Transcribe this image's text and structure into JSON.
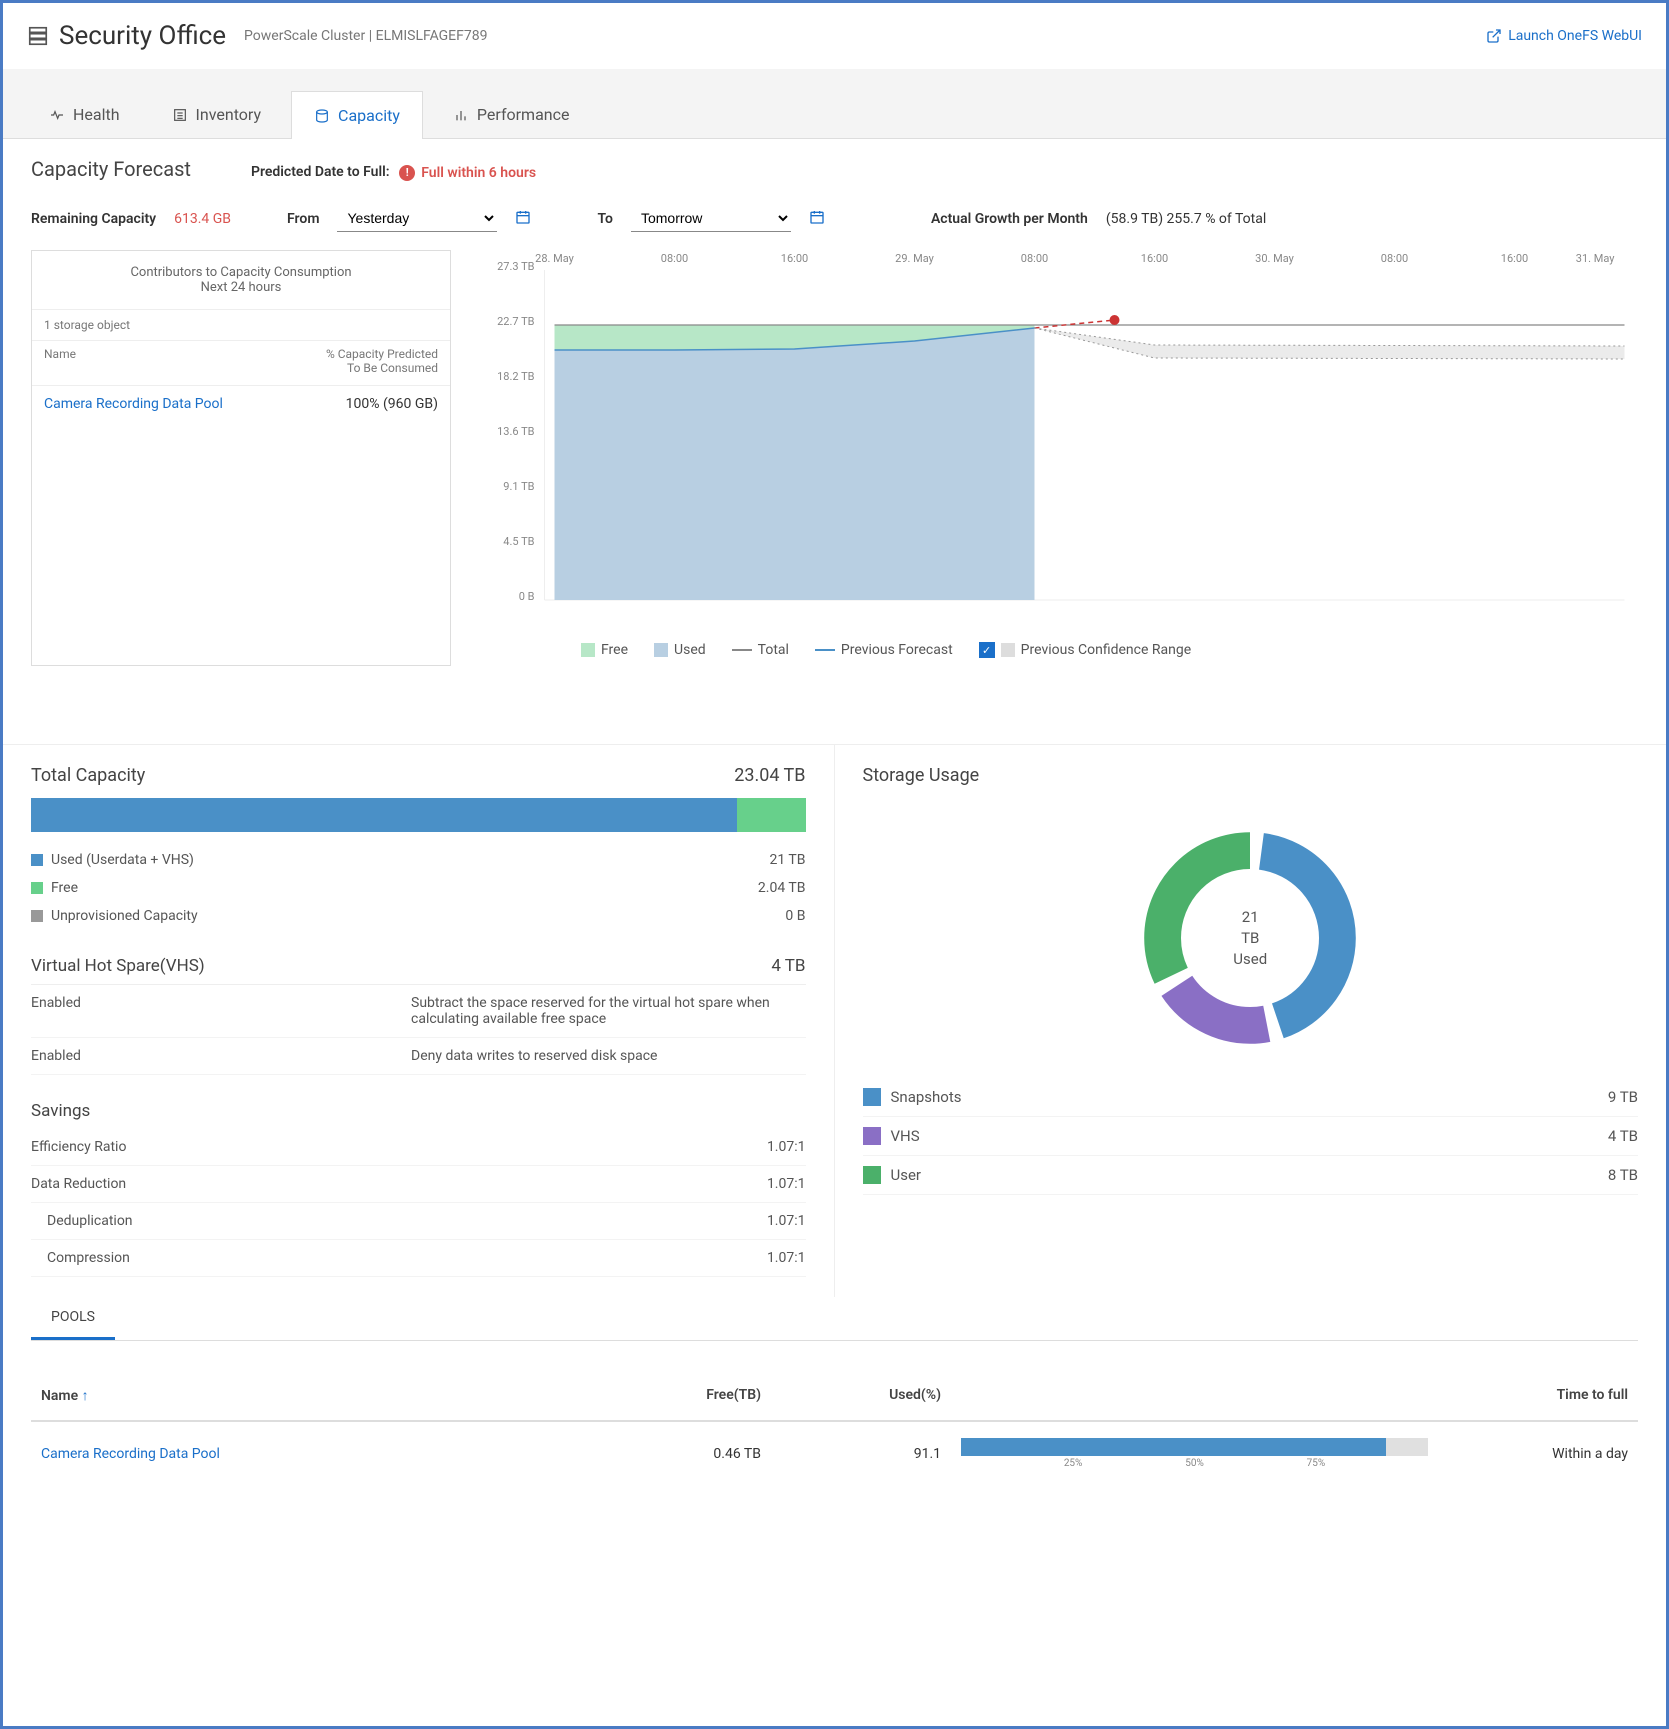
{
  "header": {
    "title": "Security Office",
    "cluster_type": "PowerScale Cluster",
    "cluster_id": "ELMISLFAGEF789",
    "launch_link": "Launch OneFS WebUI"
  },
  "tabs": [
    {
      "id": "health",
      "label": "Health"
    },
    {
      "id": "inventory",
      "label": "Inventory"
    },
    {
      "id": "capacity",
      "label": "Capacity"
    },
    {
      "id": "performance",
      "label": "Performance"
    }
  ],
  "active_tab": "capacity",
  "forecast": {
    "title": "Capacity Forecast",
    "predicted_label": "Predicted Date to Full:",
    "predicted_value": "Full within 6 hours",
    "remaining_label": "Remaining Capacity",
    "remaining_value": "613.4 GB",
    "from_label": "From",
    "from_value": "Yesterday",
    "to_label": "To",
    "to_value": "Tomorrow",
    "growth_label": "Actual Growth per Month",
    "growth_value": "(58.9 TB) 255.7 % of Total",
    "contributors": {
      "title_line1": "Contributors to Capacity Consumption",
      "title_line2": "Next 24 hours",
      "count_label": "1 storage object",
      "col_name": "Name",
      "col_pct_l1": "% Capacity Predicted",
      "col_pct_l2": "To Be Consumed",
      "rows": [
        {
          "name": "Camera Recording Data Pool",
          "value": "100% (960 GB)"
        }
      ]
    },
    "legend": {
      "free": "Free",
      "used": "Used",
      "total": "Total",
      "prev_forecast": "Previous Forecast",
      "prev_conf": "Previous Confidence Range"
    }
  },
  "chart_data": {
    "type": "area",
    "title": "Capacity Forecast",
    "xlabel": "",
    "ylabel": "",
    "ylim": [
      0,
      27.3
    ],
    "y_unit": "TB",
    "y_ticks": [
      "0 B",
      "4.5 TB",
      "9.1 TB",
      "13.6 TB",
      "18.2 TB",
      "22.7 TB",
      "27.3 TB"
    ],
    "x_ticks": [
      "28. May",
      "08:00",
      "16:00",
      "29. May",
      "08:00",
      "16:00",
      "30. May",
      "08:00",
      "16:00",
      "31. May"
    ],
    "now_index": 4,
    "series": [
      {
        "name": "Total",
        "type": "line",
        "color": "#888",
        "values": [
          22.7,
          22.7,
          22.7,
          22.7,
          22.7,
          22.7,
          22.7,
          22.7,
          22.7,
          22.7
        ]
      },
      {
        "name": "Used",
        "type": "area",
        "color": "#4a90c7",
        "values": [
          20.5,
          20.6,
          20.8,
          21.5,
          22.6,
          null,
          null,
          null,
          null,
          null
        ]
      },
      {
        "name": "Free",
        "type": "area",
        "color": "#67d08b",
        "values": [
          2.2,
          2.1,
          1.9,
          1.2,
          0.1,
          null,
          null,
          null,
          null,
          null
        ]
      },
      {
        "name": "Previous Forecast",
        "type": "line",
        "color": "#c33",
        "style": "dashed",
        "values": [
          null,
          null,
          null,
          null,
          22.6,
          22.8,
          null,
          null,
          null,
          null
        ]
      },
      {
        "name": "Previous Confidence Range",
        "type": "band",
        "color": "#bbb",
        "upper": [
          null,
          null,
          null,
          null,
          22.6,
          21.4,
          21.3,
          21.3,
          21.3,
          21.3
        ],
        "lower": [
          null,
          null,
          null,
          null,
          22.6,
          20.4,
          20.3,
          20.3,
          20.3,
          20.3
        ]
      }
    ]
  },
  "total_capacity": {
    "title": "Total Capacity",
    "total": "23.04 TB",
    "rows": [
      {
        "label": "Used (Userdata + VHS)",
        "value": "21 TB",
        "color": "#4a90c7"
      },
      {
        "label": "Free",
        "value": "2.04 TB",
        "color": "#67d08b"
      },
      {
        "label": "Unprovisioned Capacity",
        "value": "0 B",
        "color": "#999"
      }
    ],
    "used_pct": 91.1
  },
  "vhs": {
    "title": "Virtual Hot Spare(VHS)",
    "total": "4 TB",
    "rows": [
      {
        "k": "Enabled",
        "v": "Subtract the space reserved for the virtual hot spare when calculating available free space"
      },
      {
        "k": "Enabled",
        "v": "Deny data writes to reserved disk space"
      }
    ]
  },
  "savings": {
    "title": "Savings",
    "rows": [
      {
        "k": "Efficiency Ratio",
        "v": "1.07:1"
      },
      {
        "k": "Data Reduction",
        "v": "1.07:1"
      },
      {
        "k": "Deduplication",
        "v": "1.07:1",
        "indent": true
      },
      {
        "k": "Compression",
        "v": "1.07:1",
        "indent": true
      }
    ]
  },
  "storage_usage": {
    "title": "Storage Usage",
    "center_line1": "21",
    "center_line2": "TB",
    "center_line3": "Used",
    "rows": [
      {
        "label": "Snapshots",
        "value": "9 TB",
        "color": "#4a90c7"
      },
      {
        "label": "VHS",
        "value": "4 TB",
        "color": "#8a6fc5"
      },
      {
        "label": "User",
        "value": "8 TB",
        "color": "#4bb06a"
      }
    ]
  },
  "pools": {
    "tab_label": "POOLS",
    "cols": {
      "name": "Name",
      "free": "Free(TB)",
      "used": "Used(%)",
      "ttf": "Time to full"
    },
    "ticks": [
      "25%",
      "50%",
      "75%"
    ],
    "rows": [
      {
        "name": "Camera Recording Data Pool",
        "free": "0.46 TB",
        "used": "91.1",
        "used_pct": 91.1,
        "ttf": "Within a day"
      }
    ]
  }
}
